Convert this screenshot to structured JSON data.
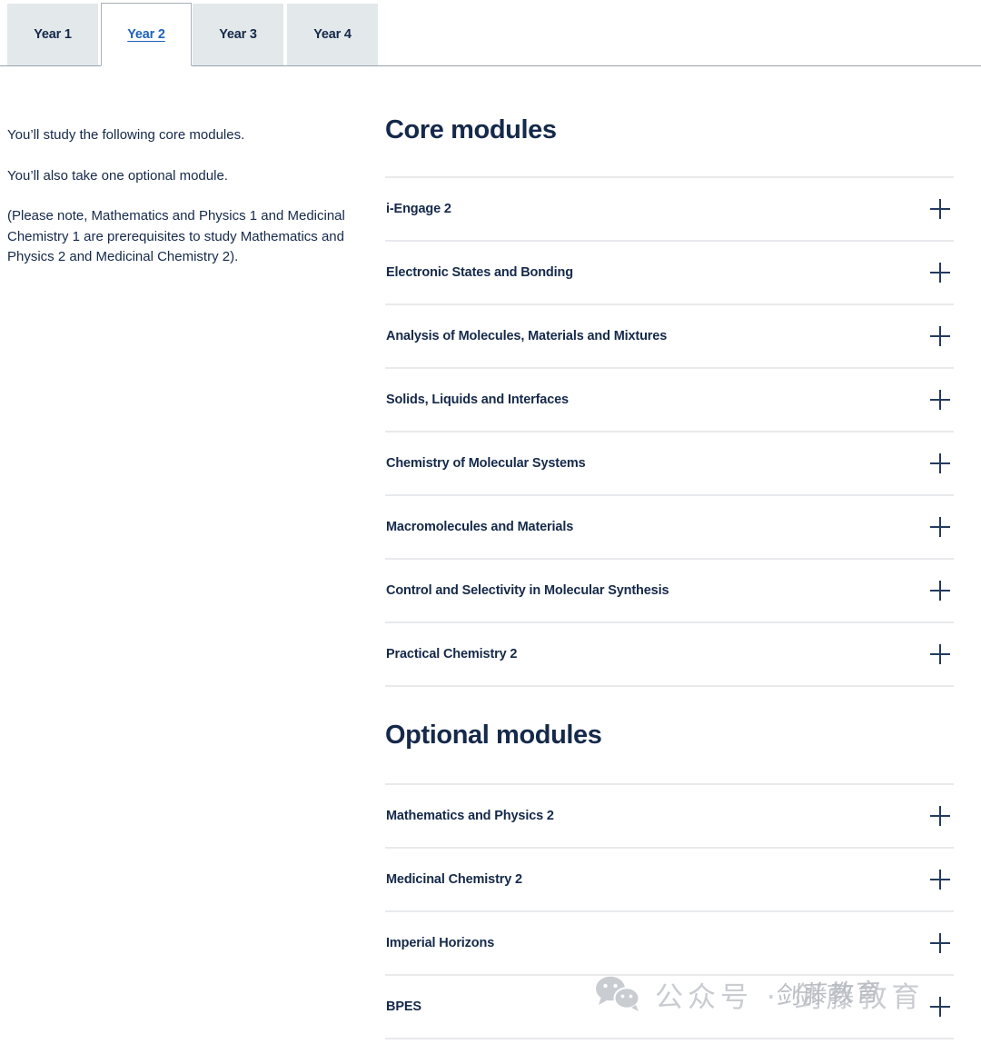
{
  "tabs": [
    {
      "label": "Year 1",
      "active": false
    },
    {
      "label": "Year 2",
      "active": true
    },
    {
      "label": "Year 3",
      "active": false
    },
    {
      "label": "Year 4",
      "active": false
    }
  ],
  "intro": {
    "paragraph_1": "You’ll study the following core modules.",
    "paragraph_2": "You’ll also take one optional module.",
    "paragraph_3": "(Please note, Mathematics and Physics 1 and Medicinal Chemistry 1 are prerequisites to study Mathematics and Physics 2 and Medicinal Chemistry 2)."
  },
  "core": {
    "heading": "Core modules",
    "modules": [
      {
        "title": "i-Engage 2",
        "expand_icon": "plus-icon"
      },
      {
        "title": "Electronic States and Bonding",
        "expand_icon": "plus-icon"
      },
      {
        "title": "Analysis of Molecules, Materials and Mixtures",
        "expand_icon": "plus-icon"
      },
      {
        "title": "Solids, Liquids and Interfaces",
        "expand_icon": "plus-icon"
      },
      {
        "title": "Chemistry of Molecular Systems",
        "expand_icon": "plus-icon"
      },
      {
        "title": "Macromolecules and Materials",
        "expand_icon": "plus-icon"
      },
      {
        "title": "Control and Selectivity in Molecular Synthesis",
        "expand_icon": "plus-icon"
      },
      {
        "title": "Practical Chemistry 2",
        "expand_icon": "plus-icon"
      }
    ]
  },
  "optional": {
    "heading": "Optional modules",
    "modules": [
      {
        "title": "Mathematics and Physics 2",
        "expand_icon": "plus-icon"
      },
      {
        "title": "Medicinal Chemistry 2",
        "expand_icon": "plus-icon"
      },
      {
        "title": "Imperial Horizons",
        "expand_icon": "plus-icon"
      },
      {
        "title": "BPES",
        "expand_icon": "plus-icon"
      }
    ]
  },
  "watermark": {
    "icon": "wechat-icon",
    "text": "公众号 · 剑藤教育",
    "overlay_text": "剑藤教育"
  },
  "colors": {
    "text_navy": "#15294a",
    "active_tab_link": "#1e62b8",
    "tab_background": "#e3e8ea",
    "divider": "#e8eaec",
    "watermark": "#c9ccd1"
  }
}
